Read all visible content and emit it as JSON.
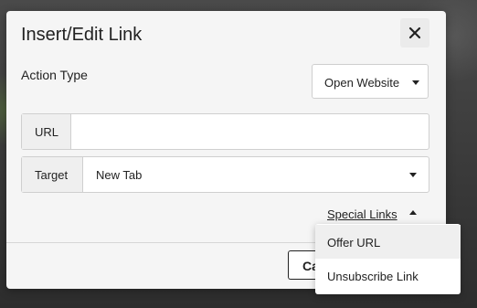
{
  "dialog": {
    "title": "Insert/Edit Link",
    "close_icon": "close-icon",
    "action_type_label": "Action Type",
    "action_type_value": "Open Website",
    "url_label": "URL",
    "url_value": "",
    "target_label": "Target",
    "target_value": "New Tab",
    "special_links_label": "Special Links",
    "cancel_label": "Cancel"
  },
  "menu": {
    "items": [
      {
        "label": "Offer URL"
      },
      {
        "label": "Unsubscribe Link"
      }
    ]
  }
}
